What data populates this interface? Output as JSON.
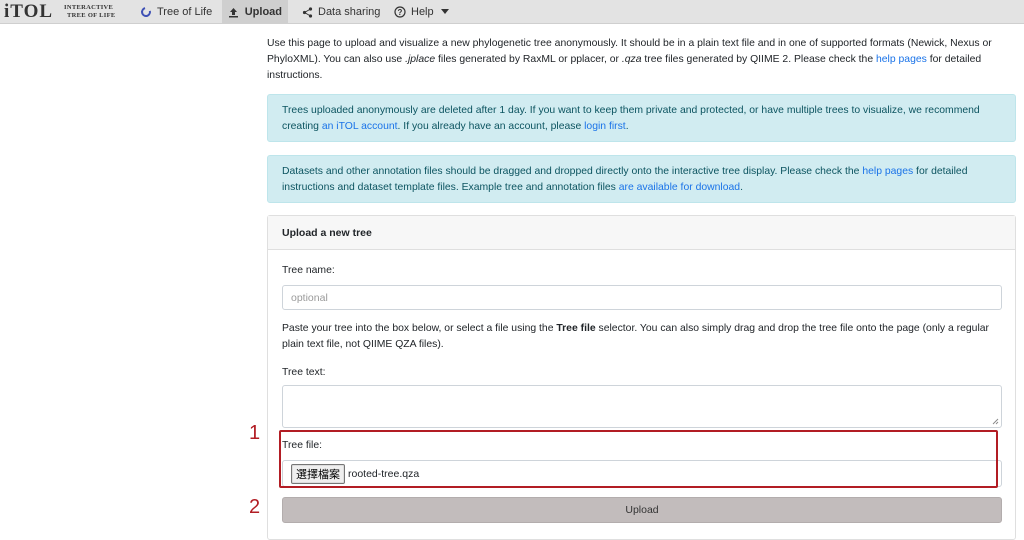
{
  "logo": {
    "main": "iTOL",
    "sub_line1": "Interactive",
    "sub_line2": "Tree Of Life"
  },
  "nav": {
    "tree_of_life": "Tree of Life",
    "upload": "Upload",
    "data_sharing": "Data sharing",
    "help": "Help"
  },
  "intro": {
    "text_a": "Use this page to upload and visualize a new phylogenetic tree anonymously. It should be in a plain text file and in one of supported formats (Newick, Nexus or PhyloXML). You can also use ",
    "jplace": ".jplace",
    "text_b": " files generated by RaxML or pplacer, or ",
    "qza": ".qza",
    "text_c": " tree files generated by QIIME 2. Please check the ",
    "help_link": "help pages",
    "text_d": " for detailed instructions."
  },
  "alert1": {
    "text_a": "Trees uploaded anonymously are deleted after 1 day. If you want to keep them private and protected, or have multiple trees to visualize, we recommend creating ",
    "account_link": "an iTOL account",
    "text_b": ". If you already have an account, please ",
    "login_link": "login first",
    "text_c": "."
  },
  "alert2": {
    "text_a": "Datasets and other annotation files should be dragged and dropped directly onto the interactive tree display. Please check the ",
    "help_link": "help pages",
    "text_b": " for detailed instructions and dataset template files. Example tree and annotation files ",
    "download_link": "are available for download",
    "text_c": "."
  },
  "card": {
    "title": "Upload a new tree",
    "tree_name_label": "Tree name:",
    "tree_name_placeholder": "optional",
    "paste_text_a": "Paste your tree into the box below, or select a file using the ",
    "paste_bold": "Tree file",
    "paste_text_b": " selector. You can also simply drag and drop the tree file onto the page (only a regular plain text file, not QIIME QZA files).",
    "tree_text_label": "Tree text:",
    "tree_file_label": "Tree file:",
    "file_button": "選擇檔案",
    "file_name": "rooted-tree.qza",
    "upload_button": "Upload"
  },
  "annotations": {
    "step1": "1",
    "step2": "2"
  },
  "colors": {
    "highlight": "#b21d24",
    "alert_bg": "#d1ecf1",
    "link": "#1a73e8",
    "navbar": "#e3e3e3"
  }
}
